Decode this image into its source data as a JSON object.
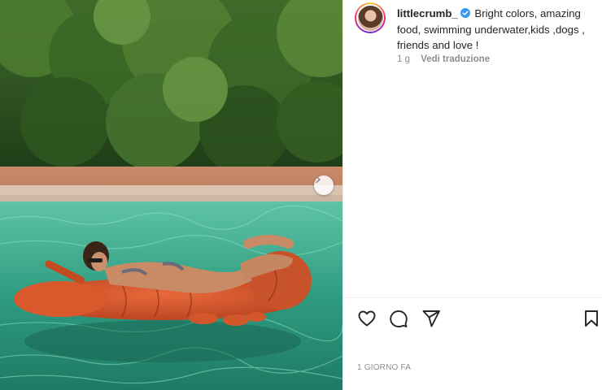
{
  "post": {
    "username": "littlecrumb_",
    "caption_text": "Bright colors, amazing food, swimming underwater,kids ,dogs , friends and love !",
    "relative_time": "1 g",
    "translate_label": "Vedi traduzione",
    "date_label": "1 GIORNO FA",
    "verified": true
  },
  "icons": {
    "like": "heart-icon",
    "comment": "comment-icon",
    "share": "send-icon",
    "save": "bookmark-icon",
    "carousel_next": "chevron-right-icon",
    "verified": "verified-badge-icon"
  },
  "colors": {
    "verified_blue": "#3897f0",
    "text": "#262626",
    "secondary_text": "#8e8e8e"
  }
}
